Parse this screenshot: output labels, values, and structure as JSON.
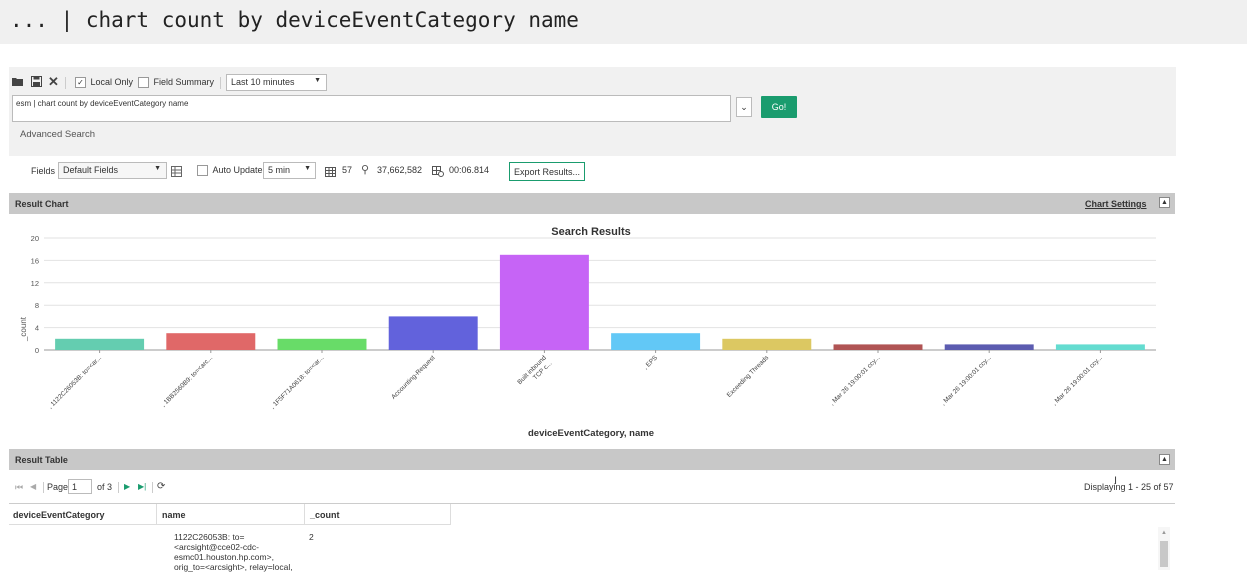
{
  "command_bar": {
    "text": "... | chart count by deviceEventCategory name"
  },
  "toolbar": {
    "local_only_label": "Local Only",
    "local_only_checked": true,
    "field_summary_label": "Field Summary",
    "field_summary_checked": false,
    "time_range": "Last 10 minutes"
  },
  "query": {
    "value": "esm | chart count by deviceEventCategory name",
    "go_label": "Go!",
    "advanced_label": "Advanced Search"
  },
  "fields_bar": {
    "fields_label": "Fields",
    "fields_value": "Default Fields",
    "auto_update_label": "Auto Update",
    "auto_update_interval": "5 min",
    "rows": "57",
    "events_scanned": "37,662,582",
    "elapsed": "00:06.814",
    "export_label": "Export Results..."
  },
  "result_chart": {
    "header": "Result Chart",
    "settings_label": "Chart Settings"
  },
  "chart_data": {
    "type": "bar",
    "title": "Search Results",
    "xlabel": "deviceEventCategory, name",
    "ylabel": "_count",
    "ylim": [
      0,
      20
    ],
    "yticks": [
      "0",
      "4",
      "8",
      "12",
      "16",
      "20"
    ],
    "categories": [
      ", 1122C26053B: to=<ar...",
      ", 1BB2560B9: to=<arc...",
      ", 1F5F71A0618: to=<ar...",
      "Accounting-Request",
      "Built inbound TCP c...",
      ", EPS",
      "Exceeding Threads",
      ", Mar 26 19:00:01 ccy...",
      ", Mar 26 19:00:01 ccy...",
      ", Mar 26 19:00:01 ccy..."
    ],
    "label_lines": [
      [
        ", 1122C26053B: to=<ar..."
      ],
      [
        ", 1BB2560B9: to=<arc..."
      ],
      [
        ", 1F5F71A0618: to=<ar..."
      ],
      [
        "Accounting-Request"
      ],
      [
        "Built inbound",
        "TCP c..."
      ],
      [
        ", EPS"
      ],
      [
        "Exceeding Threads"
      ],
      [
        ", Mar 26 19:00:01 ccy..."
      ],
      [
        ", Mar 26 19:00:01 ccy..."
      ],
      [
        ", Mar 26 19:00:01 ccy..."
      ]
    ],
    "values": [
      2,
      3,
      2,
      6,
      17,
      3,
      2,
      1,
      1,
      1
    ],
    "colors": [
      "#64cdb0",
      "#e06868",
      "#68dc68",
      "#6262dc",
      "#c664f6",
      "#62c8f6",
      "#dcc862",
      "#b05454",
      "#5c5cb0",
      "#64dcd0"
    ]
  },
  "result_table": {
    "header": "Result Table",
    "page_label": "Page",
    "page_value": "1",
    "of_label": "of 3",
    "displaying": "Displaying 1 - 25 of 57",
    "columns": [
      "deviceEventCategory",
      "name",
      "_count"
    ],
    "rows": [
      {
        "category": "",
        "name_lines": [
          "1122C26053B: to=",
          "<arcsight@cce02-cdc-",
          "esmc01.houston.hp.com>,",
          "orig_to=<arcsight>, relay=local,"
        ],
        "count": "2"
      }
    ]
  }
}
